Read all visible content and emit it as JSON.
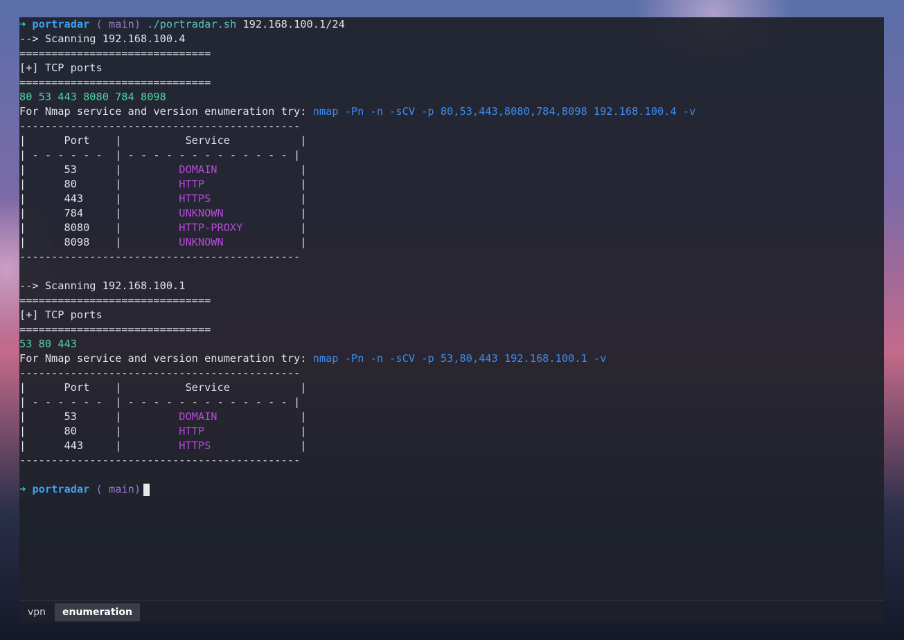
{
  "colors": {
    "terminal_bg": "#1e212a",
    "text": "#dfe3ea",
    "prompt_arrow": "#2ed0c4",
    "prompt_dir": "#3aa3f0",
    "git_info": "#9a7ad0",
    "command": "#58c4b4",
    "port_list": "#4fd6a6",
    "nmap_hint": "#3b8cf0",
    "service_name": "#b44ad6"
  },
  "prompt": {
    "arrow": "➜",
    "dir": "portradar",
    "git_open": "(",
    "branch_icon": "",
    "branch": "main",
    "git_close": ")"
  },
  "command": {
    "script": "./portradar.sh",
    "args": "192.168.100.1/24"
  },
  "scans": [
    {
      "scanning": "--> Scanning 192.168.100.4",
      "separator": "==============================",
      "header": "[+] TCP ports",
      "ports_line": "80 53 443 8080 784 8098",
      "hint_label": "For Nmap service and version enumeration try: ",
      "hint_cmd": "nmap -Pn -n -sCV -p 80,53,443,8080,784,8098 192.168.100.4 -v",
      "table_border": "--------------------------------------------",
      "table_header": "|      Port    |          Service           |",
      "table_divider": "| - - - - - -  | - - - - - - - - - - - - - |",
      "rows": [
        {
          "pre": "|      53      |         ",
          "svc": "DOMAIN",
          "post": "             |"
        },
        {
          "pre": "|      80      |         ",
          "svc": "HTTP",
          "post": "               |"
        },
        {
          "pre": "|      443     |         ",
          "svc": "HTTPS",
          "post": "              |"
        },
        {
          "pre": "|      784     |         ",
          "svc": "UNKNOWN",
          "post": "            |"
        },
        {
          "pre": "|      8080    |         ",
          "svc": "HTTP-PROXY",
          "post": "         |"
        },
        {
          "pre": "|      8098    |         ",
          "svc": "UNKNOWN",
          "post": "            |"
        }
      ]
    },
    {
      "scanning": "--> Scanning 192.168.100.1",
      "separator": "==============================",
      "header": "[+] TCP ports",
      "ports_line": "53 80 443",
      "hint_label": "For Nmap service and version enumeration try: ",
      "hint_cmd": "nmap -Pn -n -sCV -p 53,80,443 192.168.100.1 -v",
      "table_border": "--------------------------------------------",
      "table_header": "|      Port    |          Service           |",
      "table_divider": "| - - - - - -  | - - - - - - - - - - - - - |",
      "rows": [
        {
          "pre": "|      53      |         ",
          "svc": "DOMAIN",
          "post": "             |"
        },
        {
          "pre": "|      80      |         ",
          "svc": "HTTP",
          "post": "               |"
        },
        {
          "pre": "|      443     |         ",
          "svc": "HTTPS",
          "post": "              |"
        }
      ]
    }
  ],
  "tabs": [
    {
      "label": "vpn",
      "active": false
    },
    {
      "label": "enumeration",
      "active": true
    }
  ]
}
